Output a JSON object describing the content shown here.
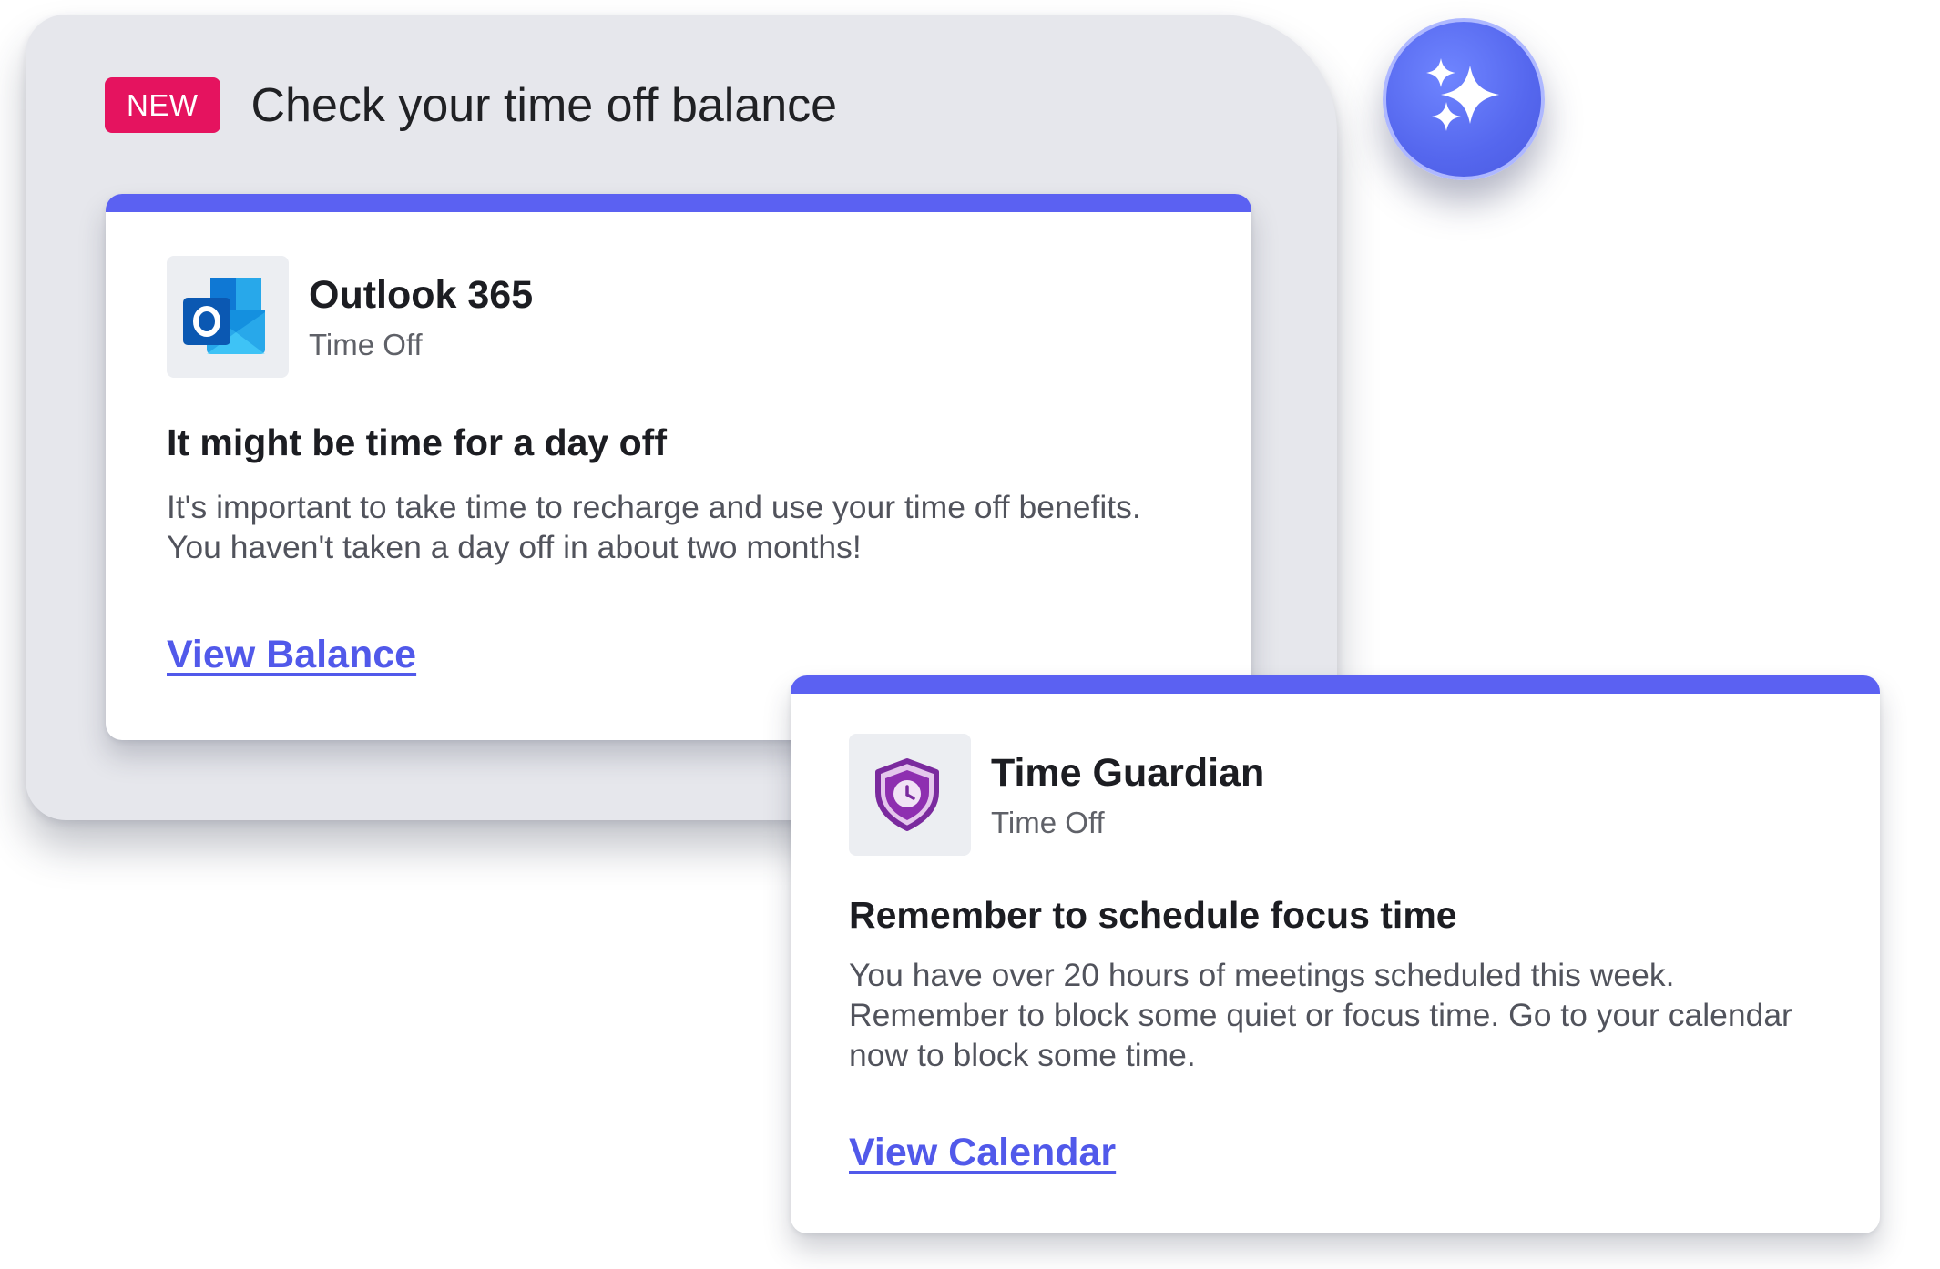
{
  "panel": {
    "badge": "NEW",
    "title": "Check your time off balance"
  },
  "spark_button": {
    "icon": "sparkles-icon"
  },
  "cards": [
    {
      "app_icon": "outlook-icon",
      "app_name": "Outlook 365",
      "category": "Time Off",
      "headline": "It might be time for a day off",
      "body": "It's important to take time to recharge and use your time off benefits. You haven't taken a day off in about two months!",
      "link": "View Balance"
    },
    {
      "app_icon": "shield-clock-icon",
      "app_name": "Time Guardian",
      "category": "Time Off",
      "headline": "Remember to schedule focus time",
      "body": "You have over 20 hours of meetings scheduled this week. Remember to block some quiet or focus time. Go to your calendar now to block some time.",
      "link": "View Calendar"
    }
  ],
  "colors": {
    "accent": "#5b61f2",
    "badge": "#e5135f",
    "link": "#5159ea",
    "panel_bg": "#e6e7ec"
  }
}
